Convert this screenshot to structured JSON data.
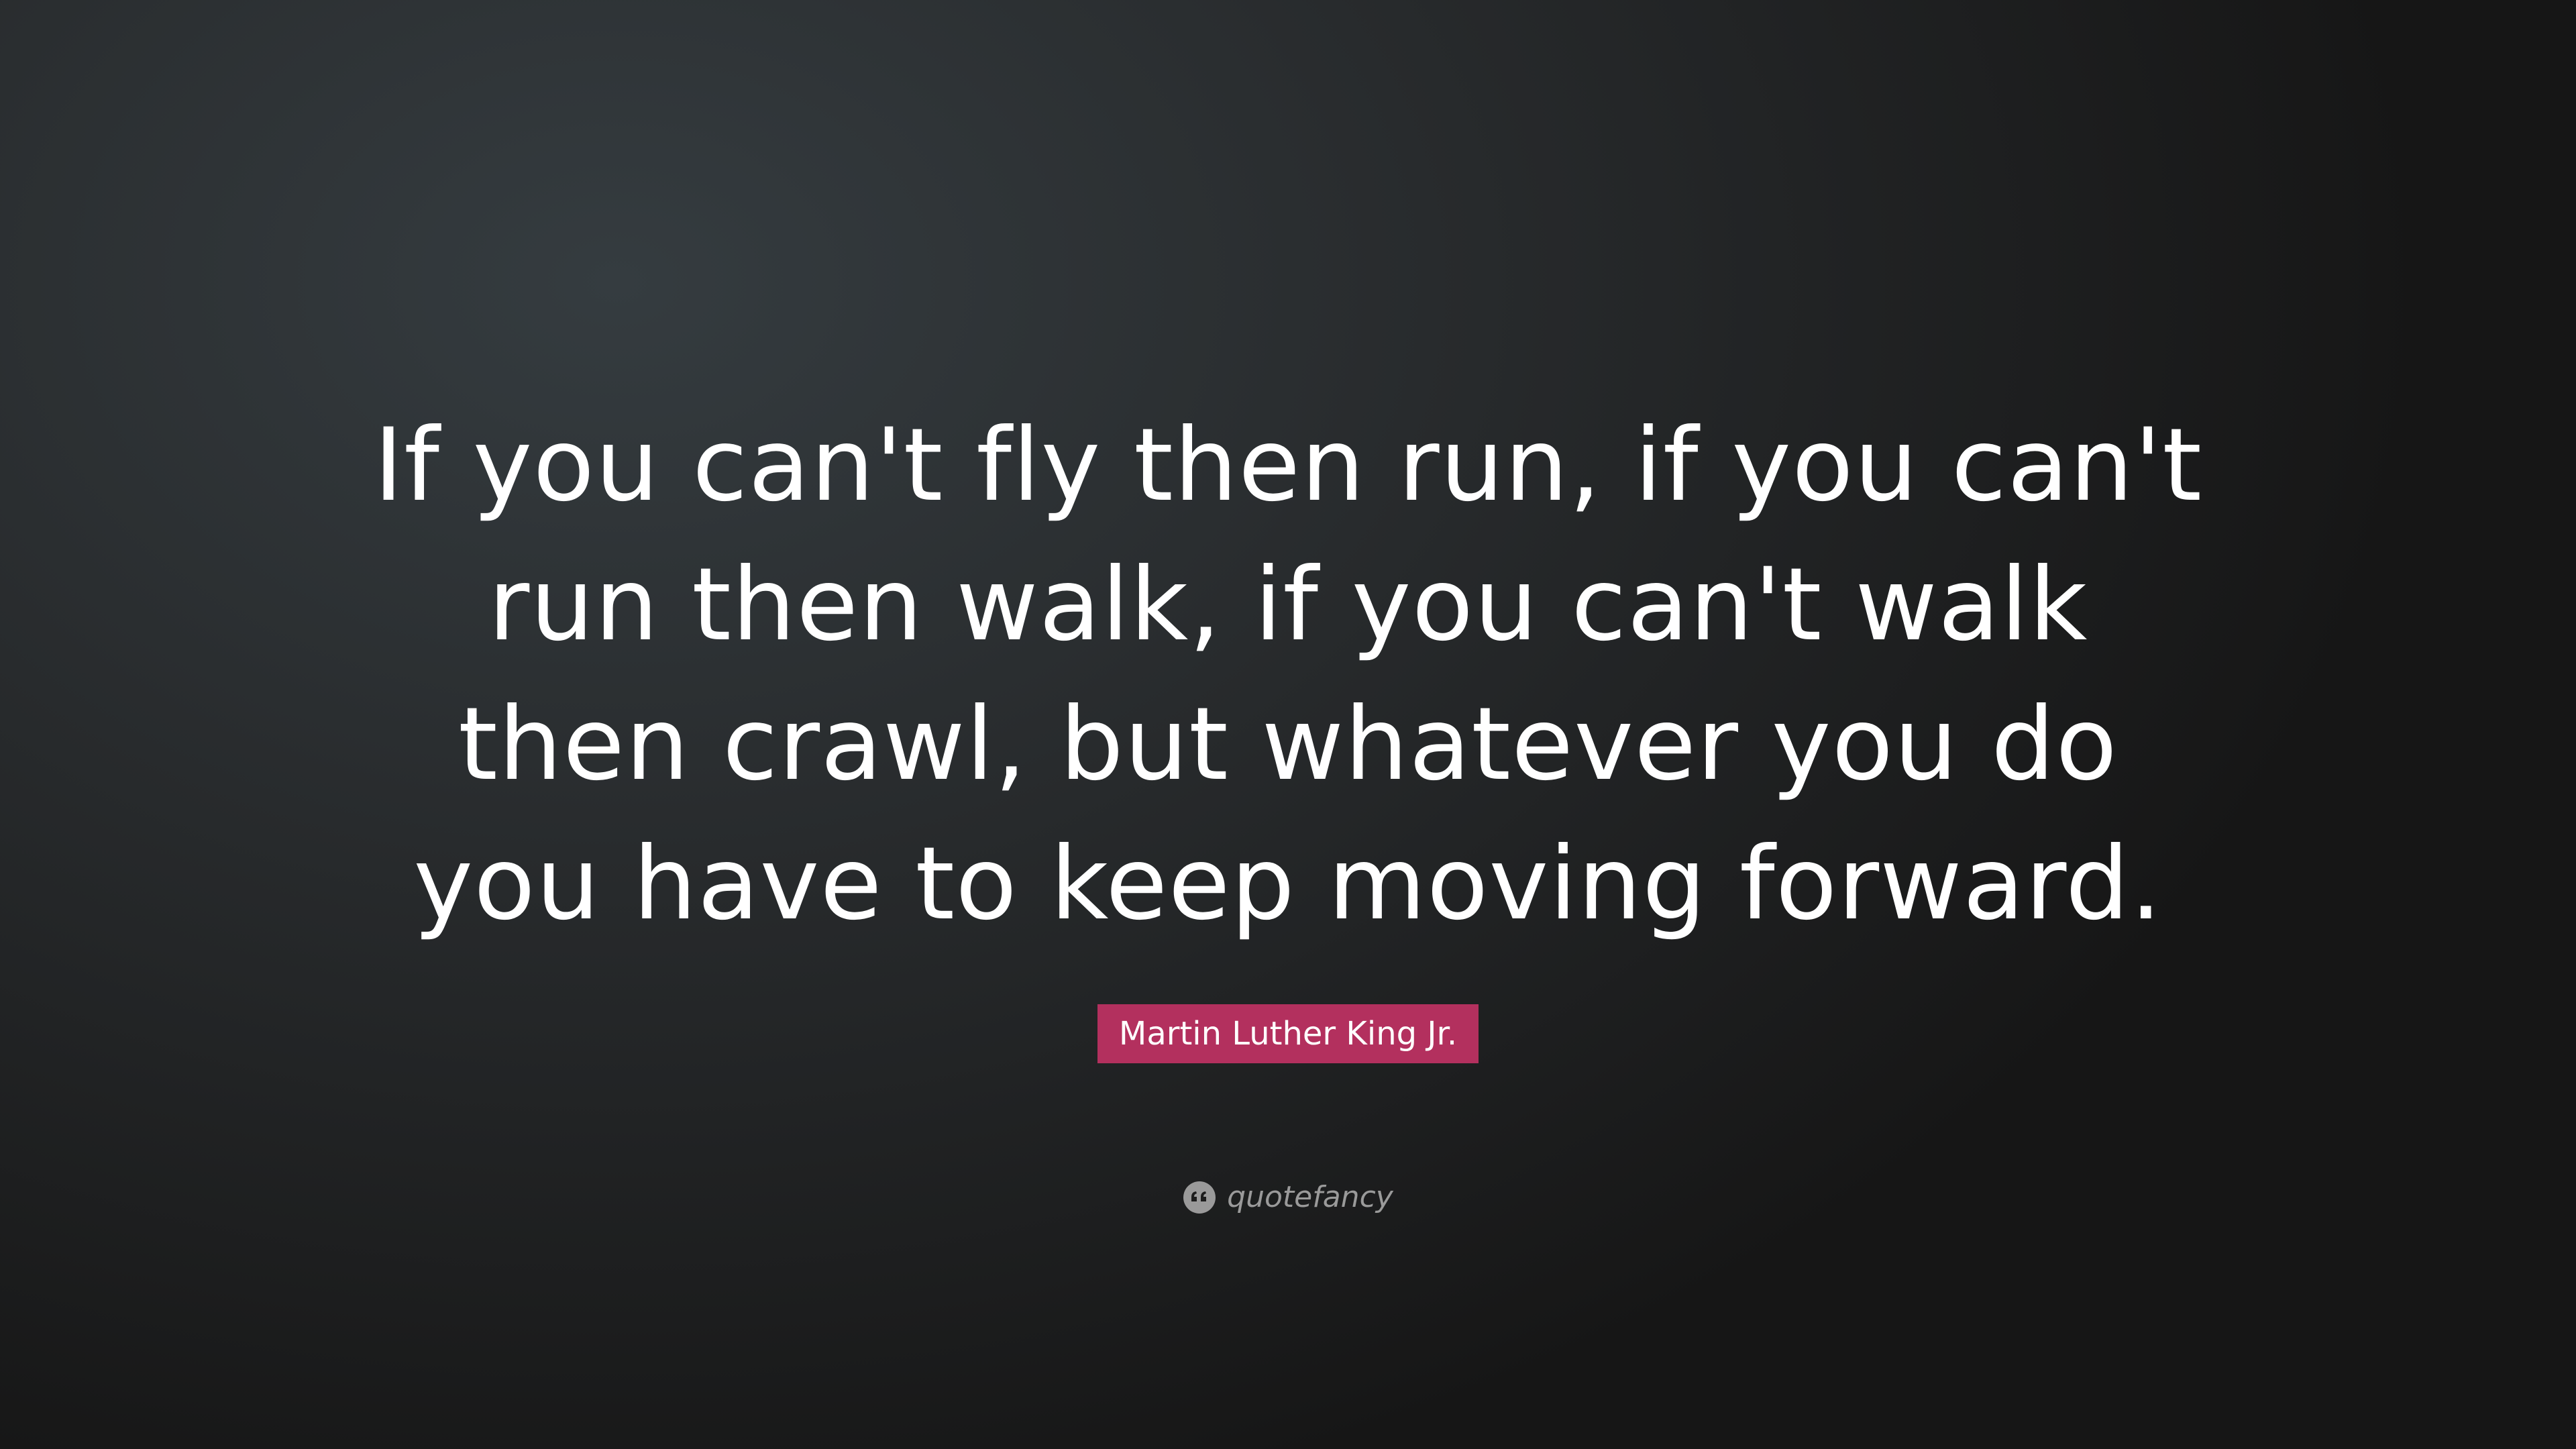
{
  "quote": {
    "lines": [
      "If you can't fly then run, if you can't",
      "run then walk, if you can't walk",
      "then crawl, but whatever you do",
      "you have to keep moving forward."
    ]
  },
  "author": {
    "name": "Martin Luther King Jr."
  },
  "brand": {
    "name": "quotefancy",
    "icon": "quote-marks-icon"
  },
  "colors": {
    "author_badge": "#b3305e",
    "text": "#ffffff",
    "brand": "#9a9a9a"
  }
}
